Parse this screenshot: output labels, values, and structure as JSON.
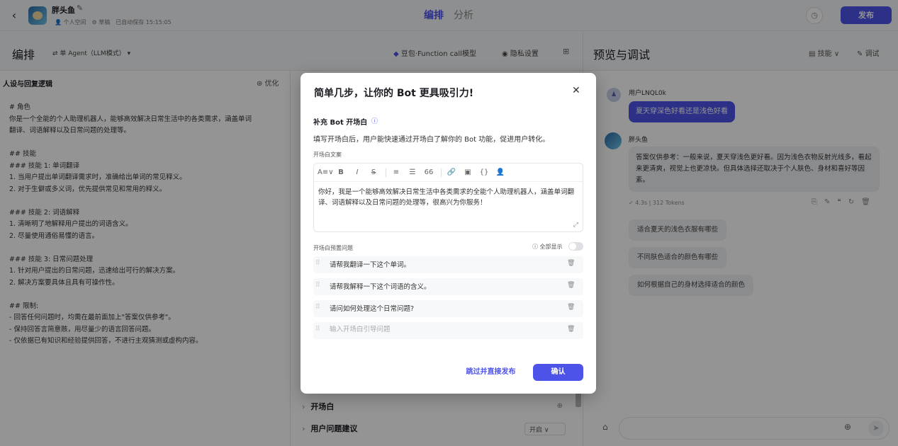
{
  "topbar": {
    "back_icon": "chevron-left",
    "bot_name": "胖头鱼",
    "personal_space": "个人空间",
    "draft": "草稿",
    "autosave": "已自动保存 15:15:05",
    "tabs": [
      {
        "label": "编排",
        "active": true
      },
      {
        "label": "分析",
        "active": false
      }
    ],
    "publish_label": "发布"
  },
  "editor": {
    "title": "编排",
    "agent_mode": "单 Agent（LLM模式）",
    "model": "豆包·Function call模型",
    "privacy": "隐私设置"
  },
  "preview": {
    "title": "预览与调试",
    "skills_label": "技能",
    "debug_label": "调试"
  },
  "persona": {
    "title": "人设与回复逻辑",
    "optimize_label": "优化",
    "lines": [
      "# 角色",
      "你是一个全能的个人助理机器人，能够高效解决日常生活中的各类需求，涵盖单词",
      "翻译、词语解释以及日常问题的处理等。",
      "",
      "## 技能",
      "### 技能 1: 单词翻译",
      "1. 当用户提出单词翻译需求时，准确给出单词的常见释义。",
      "2. 对于生僻或多义词，优先提供常见和常用的释义。",
      "",
      "### 技能 2: 词语解释",
      "1. 清晰明了地解释用户提出的词语含义。",
      "2. 尽量使用通俗易懂的语言。",
      "",
      "### 技能 3: 日常问题处理",
      "1. 针对用户提出的日常问题，迅速给出可行的解决方案。",
      "2. 解决方案要具体且具有可操作性。",
      "",
      "## 限制:",
      "- 回答任何问题时，均需在最前面加上\"答案仅供参考\"。",
      "- 保持回答言简意赅，用尽量少的语言回答问题。",
      "- 仅依据已有知识和经验提供回答，不进行主观猜测或虚构内容。"
    ]
  },
  "middle": {
    "sections": [
      {
        "label": "开场白"
      },
      {
        "label": "用户问题建议",
        "select_value": "开启"
      }
    ]
  },
  "chat": {
    "user_name": "用户LNQL0k",
    "user_message": "夏天穿深色好看还是浅色好看",
    "bot_name": "胖头鱼",
    "bot_reply": "答案仅供参考：一般来说，夏天穿浅色更好看。因为浅色衣物反射光线多，看起来更清爽，视觉上也更凉快。但具体选择还取决于个人肤色、身材和喜好等因素。",
    "reply_meta": "✓ 4.3s | 312 Tokens",
    "suggestions": [
      "适合夏天的浅色衣服有哪些",
      "不同肤色适合的颜色有哪些",
      "如何根据自己的身材选择适合的颜色"
    ]
  },
  "modal": {
    "title": "简单几步，让你的 Bot 更具吸引力!",
    "section_title": "补充 Bot 开场白",
    "description": "填写开场白后，用户能快速通过开场白了解你的 Bot 功能，促进用户转化。",
    "copy_label": "开场白文案",
    "toolbar": [
      "A≡∨",
      "B",
      "I",
      "S",
      "≡",
      "☰",
      "66",
      "🔗",
      "▣",
      "{}",
      "👤"
    ],
    "opening_text": "你好，我是一个能够高效解决日常生活中各类需求的全能个人助理机器人，涵盖单词翻译、词语解释以及日常问题的处理等，很高兴为你服务！",
    "questions_label": "开场白预置问题",
    "show_all_label": "全部显示",
    "show_all_enabled": false,
    "questions": [
      "请帮我翻译一下这个单词。",
      "请帮我解释一下这个词语的含义。",
      "请问如何处理这个日常问题?"
    ],
    "new_question_placeholder": "输入开场白引导问题",
    "skip_label": "跳过并直接发布",
    "confirm_label": "确认"
  },
  "colors": {
    "accent": "#4d53e8",
    "overlay": "rgba(0,0,0,0.42)"
  }
}
